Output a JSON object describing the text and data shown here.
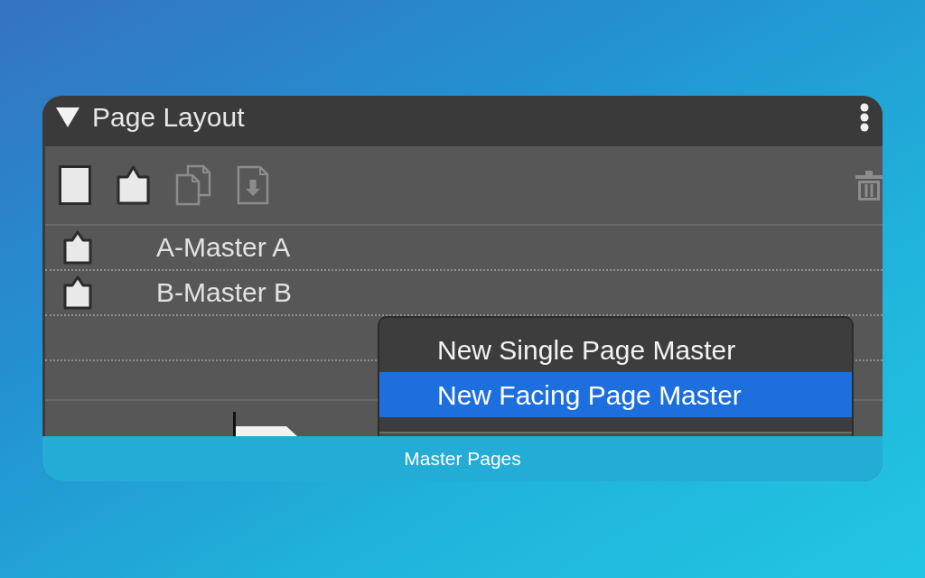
{
  "panel": {
    "title": "Page Layout",
    "expanded": true
  },
  "toolbar": [
    {
      "kind": "page",
      "disabled": false
    },
    {
      "kind": "master",
      "disabled": false
    },
    {
      "kind": "duplicate",
      "disabled": true
    },
    {
      "kind": "import",
      "disabled": true
    },
    {
      "kind": "delete",
      "disabled": true
    }
  ],
  "masters": [
    {
      "name": "A-Master A"
    },
    {
      "name": "B-Master B"
    }
  ],
  "menu": {
    "items": [
      {
        "label": "New Single Page Master",
        "selected": false
      },
      {
        "label": "New Facing Page Master",
        "selected": true
      }
    ]
  },
  "caption": "Master Pages"
}
